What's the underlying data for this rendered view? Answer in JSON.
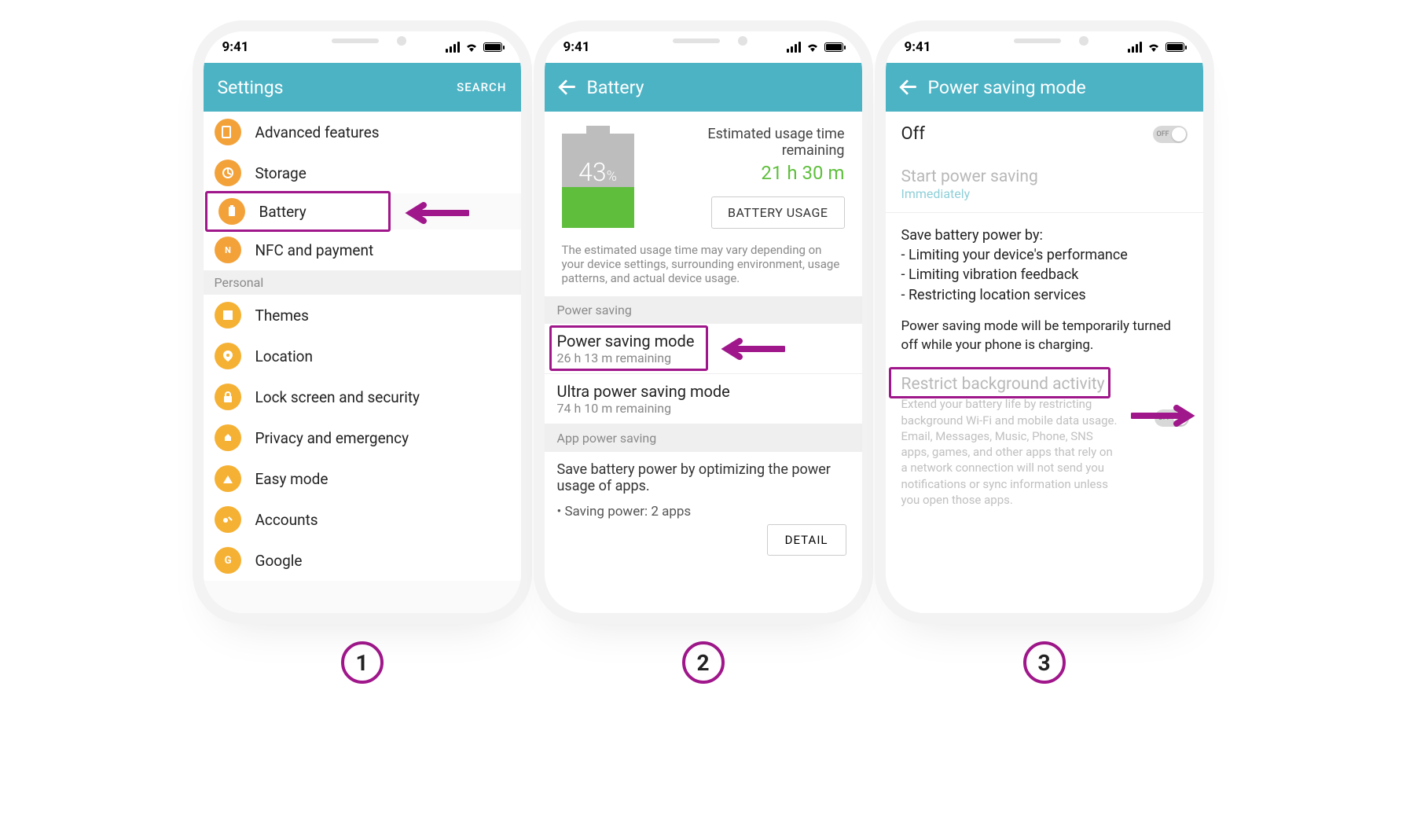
{
  "statusbar": {
    "time": "9:41"
  },
  "steps": {
    "s1": "1",
    "s2": "2",
    "s3": "3"
  },
  "screen1": {
    "title": "Settings",
    "search": "SEARCH",
    "items": {
      "advanced": "Advanced features",
      "storage": "Storage",
      "battery": "Battery",
      "nfc": "NFC and payment",
      "personal_header": "Personal",
      "themes": "Themes",
      "location": "Location",
      "lock": "Lock screen and security",
      "privacy": "Privacy and emergency",
      "easy": "Easy mode",
      "accounts": "Accounts",
      "google": "Google"
    }
  },
  "screen2": {
    "title": "Battery",
    "pct": "43",
    "pct_sign": "%",
    "est_label": "Estimated usage time remaining",
    "est_time": "21 h 30 m",
    "usage_btn": "BATTERY USAGE",
    "note": "The estimated usage time may vary depending on your device settings, surrounding environment, usage patterns, and actual device usage.",
    "sec_power": "Power saving",
    "psm_title": "Power saving mode",
    "psm_sub": "26 h 13 m remaining",
    "upsm_title": "Ultra power saving mode",
    "upsm_sub": "74 h 10 m remaining",
    "sec_app": "App power saving",
    "app_desc": "Save battery power by optimizing the power usage of apps.",
    "saving_count": "•   Saving power: 2 apps",
    "detail_btn": "DETAIL"
  },
  "screen3": {
    "title": "Power saving mode",
    "off_label": "Off",
    "toggle_off_text": "OFF",
    "start_label": "Start power saving",
    "start_value": "Immediately",
    "desc_head": "Save battery power by:",
    "desc_l1": "- Limiting your device's performance",
    "desc_l2": "- Limiting vibration feedback",
    "desc_l3": "- Restricting location services",
    "desc_charging": "Power saving mode will be temporarily turned off while your phone is charging.",
    "restrict_title": "Restrict background activity",
    "restrict_desc": "Extend your battery life by restricting background Wi-Fi and mobile data usage. Email, Messages, Music, Phone, SNS apps, games, and other apps that rely on a network connection will not send you notifications or sync information unless you open those apps."
  }
}
